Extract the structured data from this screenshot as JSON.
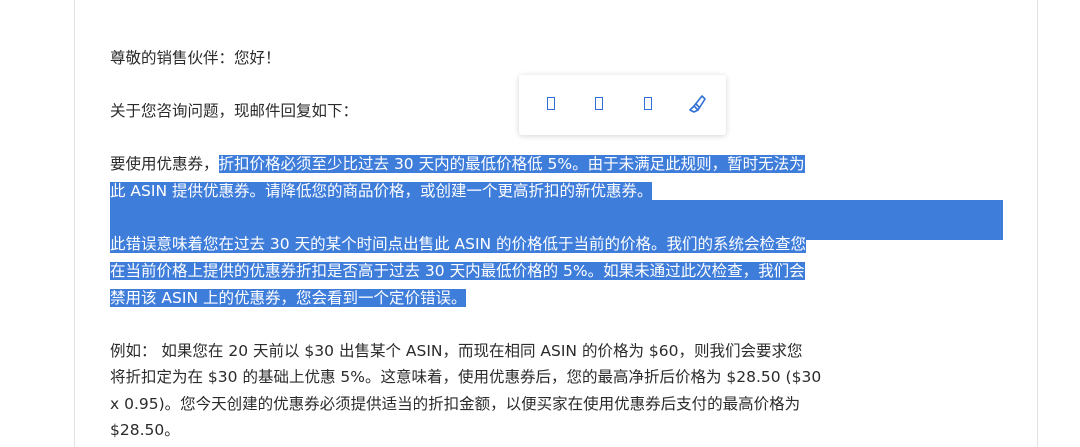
{
  "email": {
    "greeting": "尊敬的销售伙伴：您好！",
    "intro": "关于您咨询问题，现邮件回复如下：",
    "p1_plain": "要使用优惠券，",
    "p1_hl_1": "折扣价格必须至少比过去 30 天内的最低价格低 5%。由于未满足此规则，暂时无法为",
    "p1_hl_2": "此 ASIN 提供优惠券。请降低您的商品价格，或创建一个更高折扣的新优惠券。",
    "p2_hl_1": "此错误意味着您在过去 30 天的某个时间点出售此 ASIN 的价格低于当前的价格。我们的系统会检查您",
    "p2_hl_2": "在当前价格上提供的优惠券折扣是否高于过去 30 天内最低价格的 5%。如果未通过此次检查，我们会",
    "p2_hl_3": "禁用该 ASIN 上的优惠券，您会看到一个定价错误。",
    "p3_1": "例如： 如果您在 20 天前以 $30 出售某个 ASIN，而现在相同 ASIN 的价格为 $60，则我们会要求您",
    "p3_2": "将折扣定为在 $30 的基础上优惠 5%。这意味着，使用优惠券后，您的最高净折后价格为 $28.50 ($30",
    "p3_3": "x 0.95)。您今天创建的优惠券必须提供适当的折扣金额，以便买家在使用优惠券后支付的最高价格为",
    "p3_4": "$28.50。"
  },
  "toolbar": {
    "icons": [
      "box-icon",
      "box-icon",
      "box-icon",
      "highlighter-icon"
    ],
    "accent": "#2f6fd6"
  },
  "colors": {
    "selection": "#3f7ddb",
    "text": "#2b2b2b"
  }
}
